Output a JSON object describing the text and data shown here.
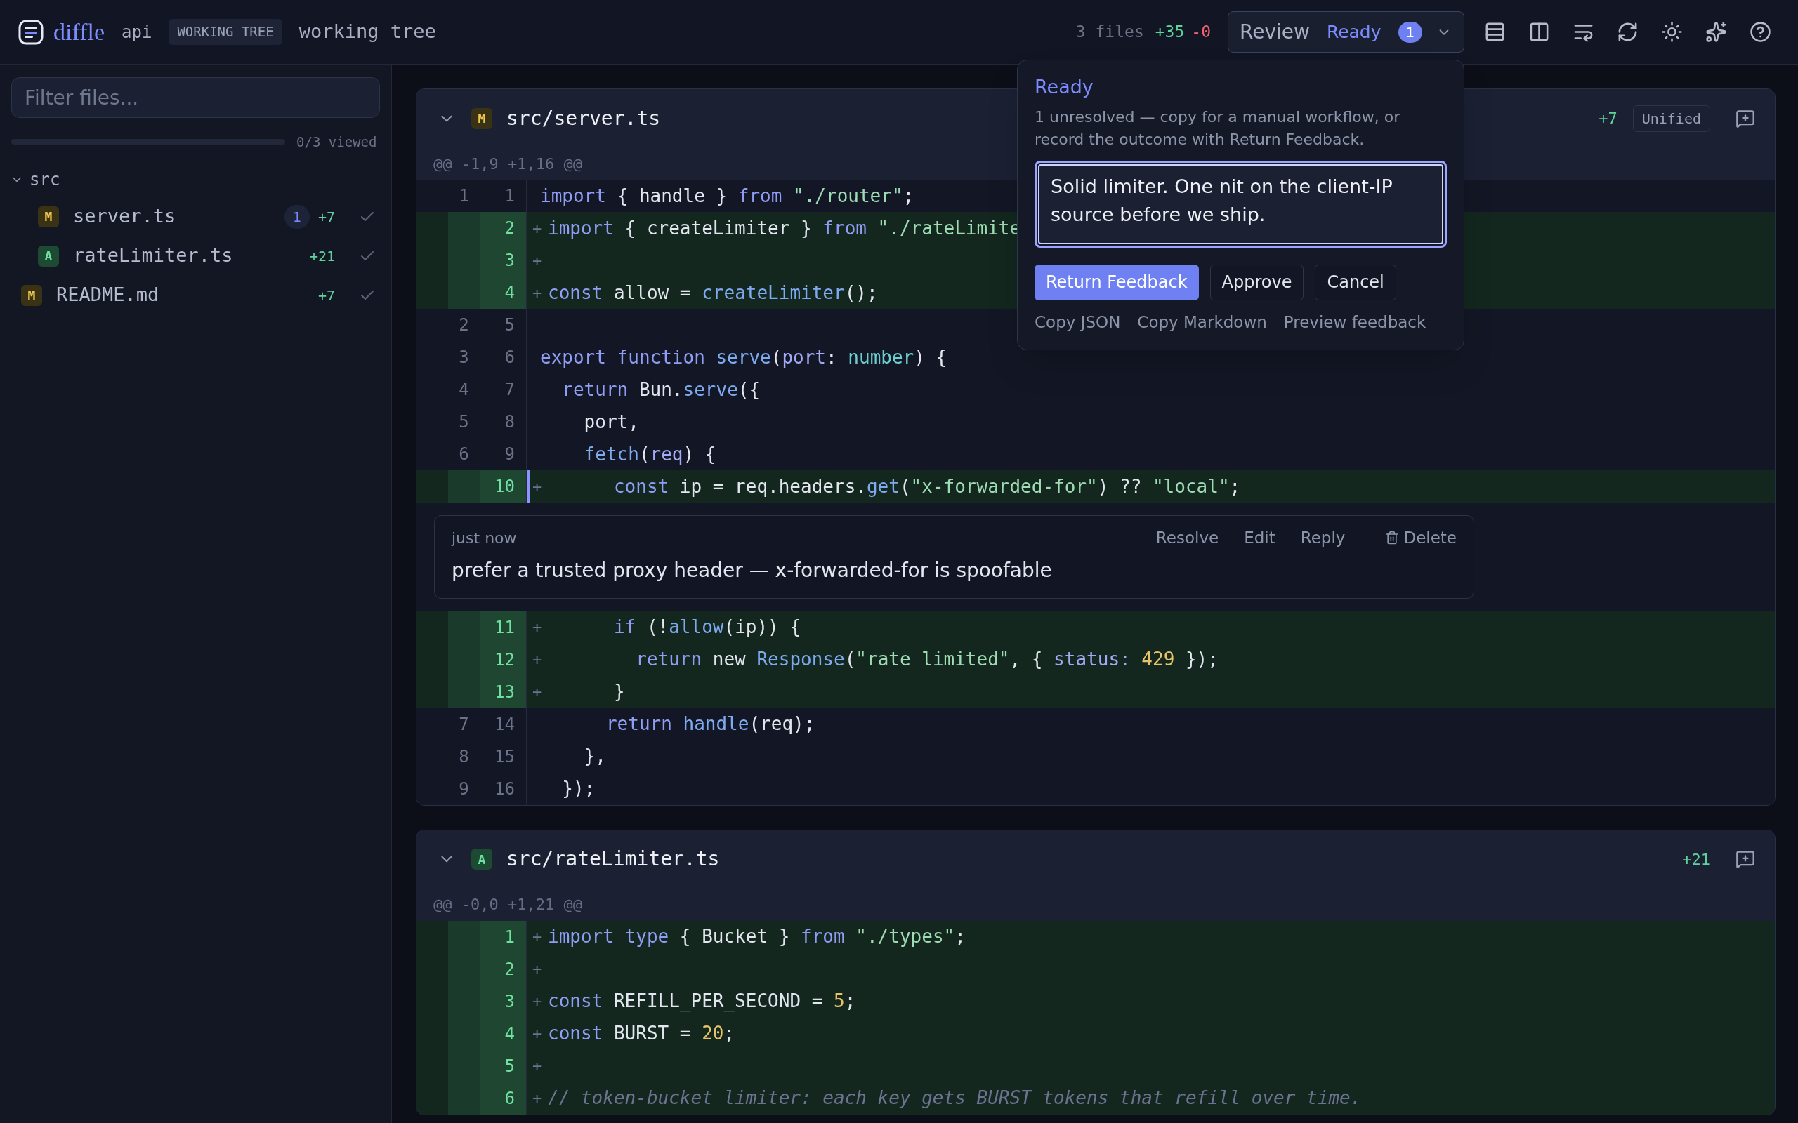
{
  "header": {
    "logo": "diffle",
    "repo": "api",
    "ref_badge": "WORKING TREE",
    "ref_label": "working tree",
    "summary": {
      "files": "3 files",
      "added": "+35",
      "removed": "-0"
    },
    "review": {
      "label": "Review",
      "status": "Ready",
      "count": "1",
      "expanded": true
    }
  },
  "sidebar": {
    "filter_placeholder": "Filter files...",
    "progress": {
      "level": 0,
      "label": "0/3 viewed"
    },
    "tree": [
      {
        "kind": "folder",
        "name": "src",
        "expanded": true,
        "children": [
          {
            "kind": "modified",
            "name": "server.ts",
            "status": "M",
            "comments": "1",
            "added": "+7",
            "viewed": false
          },
          {
            "kind": "added",
            "name": "rateLimiter.ts",
            "status": "A",
            "added": "+21",
            "viewed": false
          }
        ]
      },
      {
        "kind": "modified",
        "name": "README.md",
        "status": "M",
        "added": "+7",
        "viewed": false
      }
    ]
  },
  "files": [
    {
      "path": "src/server.ts",
      "kind": "modified",
      "status": "M",
      "expanded": true,
      "added": "+7",
      "view_mode": "Unified",
      "hunk": "@@ -1,9 +1,16 @@",
      "lines": [
        {
          "kind": "ctx",
          "old": "1",
          "new": "1",
          "tokens": [
            {
              "kind": "kw",
              "text": "import"
            },
            {
              "kind": "id",
              "text": " { handle } "
            },
            {
              "kind": "kw",
              "text": "from"
            },
            {
              "kind": "str",
              "text": " \"./router\""
            },
            {
              "kind": "id",
              "text": ";"
            }
          ]
        },
        {
          "kind": "add",
          "new": "2",
          "sign": "+",
          "tokens": [
            {
              "kind": "kw",
              "text": "import"
            },
            {
              "kind": "id",
              "text": " { createLimiter } "
            },
            {
              "kind": "kw",
              "text": "from"
            },
            {
              "kind": "str",
              "text": " \"./rateLimite"
            }
          ]
        },
        {
          "kind": "add",
          "new": "3",
          "sign": "+"
        },
        {
          "kind": "add",
          "new": "4",
          "sign": "+",
          "tokens": [
            {
              "kind": "kw",
              "text": "const"
            },
            {
              "kind": "id",
              "text": " allow = "
            },
            {
              "kind": "fn",
              "text": "createLimiter"
            },
            {
              "kind": "id",
              "text": "();"
            }
          ]
        },
        {
          "kind": "ctx",
          "old": "2",
          "new": "5"
        },
        {
          "kind": "ctx",
          "old": "3",
          "new": "6",
          "tokens": [
            {
              "kind": "kw",
              "text": "export function"
            },
            {
              "kind": "fn",
              "text": " serve"
            },
            {
              "kind": "id",
              "text": "("
            },
            {
              "kind": "param",
              "text": "port"
            },
            {
              "kind": "id",
              "text": ": "
            },
            {
              "kind": "type",
              "text": "number"
            },
            {
              "kind": "id",
              "text": ") {"
            }
          ]
        },
        {
          "kind": "ctx",
          "old": "4",
          "new": "7",
          "tokens": [
            {
              "kind": "kw",
              "text": "  return"
            },
            {
              "kind": "id",
              "text": " Bun."
            },
            {
              "kind": "fn",
              "text": "serve"
            },
            {
              "kind": "id",
              "text": "({"
            }
          ]
        },
        {
          "kind": "ctx",
          "old": "5",
          "new": "8",
          "tokens": [
            {
              "kind": "id",
              "text": "    port,"
            }
          ]
        },
        {
          "kind": "ctx",
          "old": "6",
          "new": "9",
          "tokens": [
            {
              "kind": "fn",
              "text": "    fetch"
            },
            {
              "kind": "id",
              "text": "("
            },
            {
              "kind": "param",
              "text": "req"
            },
            {
              "kind": "id",
              "text": ") {"
            }
          ]
        },
        {
          "kind": "add",
          "new": "10",
          "sign": "+",
          "tokens": [
            {
              "kind": "kw",
              "text": "      const"
            },
            {
              "kind": "id",
              "text": " ip = req.headers."
            },
            {
              "kind": "fn",
              "text": "get"
            },
            {
              "kind": "id",
              "text": "("
            },
            {
              "kind": "str",
              "text": "\"x-forwarded-for\""
            },
            {
              "kind": "id",
              "text": ") ?? "
            },
            {
              "kind": "str",
              "text": "\"local\""
            },
            {
              "kind": "id",
              "text": ";"
            }
          ],
          "comment": {
            "time": "just now",
            "actions": [
              "Resolve",
              "Edit",
              "Reply"
            ],
            "delete": "Delete",
            "body": "prefer a trusted proxy header — x-forwarded-for is spoofable"
          }
        },
        {
          "kind": "add",
          "new": "11",
          "sign": "+",
          "tokens": [
            {
              "kind": "kw",
              "text": "      if"
            },
            {
              "kind": "id",
              "text": " (!"
            },
            {
              "kind": "fn",
              "text": "allow"
            },
            {
              "kind": "id",
              "text": "(ip)) {"
            }
          ]
        },
        {
          "kind": "add",
          "new": "12",
          "sign": "+",
          "tokens": [
            {
              "kind": "kw",
              "text": "        return"
            },
            {
              "kind": "id",
              "text": " new "
            },
            {
              "kind": "fn",
              "text": "Response"
            },
            {
              "kind": "id",
              "text": "("
            },
            {
              "kind": "str",
              "text": "\"rate limited\""
            },
            {
              "kind": "id",
              "text": ", { "
            },
            {
              "kind": "param",
              "text": "status:"
            },
            {
              "kind": "num",
              "text": " 429"
            },
            {
              "kind": "id",
              "text": " });"
            }
          ]
        },
        {
          "kind": "add",
          "new": "13",
          "sign": "+",
          "tokens": [
            {
              "kind": "id",
              "text": "      }"
            }
          ]
        },
        {
          "kind": "ctx",
          "old": "7",
          "new": "14",
          "tokens": [
            {
              "kind": "kw",
              "text": "      return"
            },
            {
              "kind": "fn",
              "text": " handle"
            },
            {
              "kind": "id",
              "text": "(req);"
            }
          ]
        },
        {
          "kind": "ctx",
          "old": "8",
          "new": "15",
          "tokens": [
            {
              "kind": "id",
              "text": "    },"
            }
          ]
        },
        {
          "kind": "ctx",
          "old": "9",
          "new": "16",
          "tokens": [
            {
              "kind": "id",
              "text": "  });"
            }
          ]
        }
      ]
    },
    {
      "path": "src/rateLimiter.ts",
      "kind": "added",
      "status": "A",
      "expanded": true,
      "added": "+21",
      "hunk": "@@ -0,0 +1,21 @@",
      "lines": [
        {
          "kind": "add",
          "new": "1",
          "sign": "+",
          "tokens": [
            {
              "kind": "kw",
              "text": "import type"
            },
            {
              "kind": "id",
              "text": " { Bucket } "
            },
            {
              "kind": "kw",
              "text": "from"
            },
            {
              "kind": "str",
              "text": " \"./types\""
            },
            {
              "kind": "id",
              "text": ";"
            }
          ]
        },
        {
          "kind": "add",
          "new": "2",
          "sign": "+"
        },
        {
          "kind": "add",
          "new": "3",
          "sign": "+",
          "tokens": [
            {
              "kind": "kw",
              "text": "const"
            },
            {
              "kind": "id",
              "text": " REFILL_PER_SECOND = "
            },
            {
              "kind": "num",
              "text": "5"
            },
            {
              "kind": "id",
              "text": ";"
            }
          ]
        },
        {
          "kind": "add",
          "new": "4",
          "sign": "+",
          "tokens": [
            {
              "kind": "kw",
              "text": "const"
            },
            {
              "kind": "id",
              "text": " BURST = "
            },
            {
              "kind": "num",
              "text": "20"
            },
            {
              "kind": "id",
              "text": ";"
            }
          ]
        },
        {
          "kind": "add",
          "new": "5",
          "sign": "+"
        },
        {
          "kind": "add",
          "new": "6",
          "sign": "+",
          "tokens": [
            {
              "kind": "cm",
              "text": "// token-bucket limiter: each key gets BURST tokens that refill over time."
            }
          ]
        }
      ]
    }
  ],
  "popover": {
    "title": "Ready",
    "description": "1 unresolved — copy for a manual workflow, or record the outcome with Return Feedback.",
    "feedback": "Solid limiter. One nit on the client-IP source before we ship.",
    "buttons": [
      {
        "label": "Return Feedback",
        "primary": true
      },
      {
        "label": "Approve",
        "primary": false
      },
      {
        "label": "Cancel",
        "primary": false
      }
    ],
    "links": [
      "Copy JSON",
      "Copy Markdown",
      "Preview feedback"
    ]
  }
}
